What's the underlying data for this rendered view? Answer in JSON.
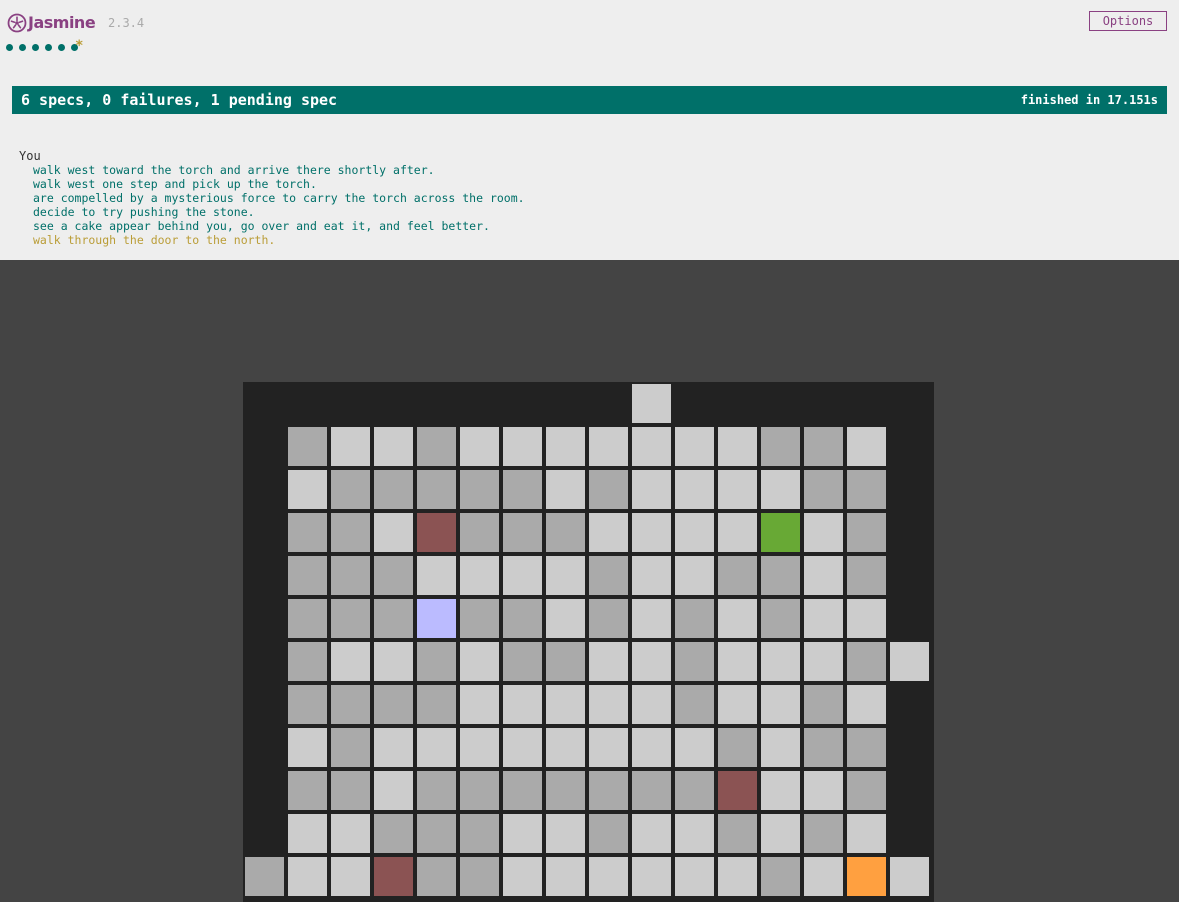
{
  "header": {
    "logo_text": "Jasmine",
    "version": "2.3.4",
    "options_label": "Options",
    "spec_dots": [
      "passed",
      "passed",
      "passed",
      "passed",
      "passed",
      "passed"
    ],
    "pending_symbol": "*"
  },
  "summary_bar": {
    "summary": "6 specs, 0 failures, 1 pending spec",
    "duration": "finished in 17.151s",
    "color": "#007069"
  },
  "results": {
    "suite": "You",
    "specs": [
      {
        "text": "walk west toward the torch and arrive there shortly after.",
        "status": "passed"
      },
      {
        "text": "walk west one step and pick up the torch.",
        "status": "passed"
      },
      {
        "text": "are compelled by a mysterious force to carry the torch across the room.",
        "status": "passed"
      },
      {
        "text": "decide to try pushing the stone.",
        "status": "passed"
      },
      {
        "text": "see a cake appear behind you, go over and eat it, and feel better.",
        "status": "passed"
      },
      {
        "text": "walk through the door to the north.",
        "status": "pending"
      }
    ]
  },
  "game": {
    "colors": {
      "light_floor": "#cccccc",
      "dark_floor": "#aaaaaa",
      "stone": "#8b5353",
      "green": "#68a935",
      "player": "#bbbbff",
      "orange": "#ffa040",
      "wall": "#222222"
    },
    "door_north": {
      "col": 8
    },
    "door_east": {
      "row": 6
    },
    "door_west": {
      "row": 11
    },
    "grid": [
      "dlldlllllllddl",
      "ldddddldlllldd",
      "ddlrdddllllgld",
      "dddlllldllddld",
      "dddpddldldldll",
      "dlldlddlldllld",
      "ddddllllldlldl",
      "ldlllllllldldd",
      "ddldddddddrlld",
      "lldddlldlldldl",
      "llrddlllllldlol"
    ]
  }
}
